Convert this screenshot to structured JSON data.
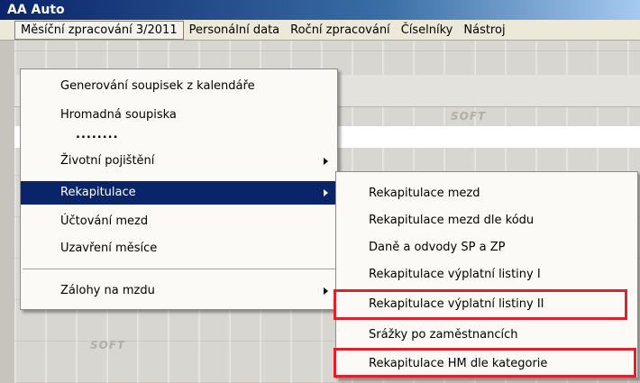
{
  "window": {
    "title": "AA Auto"
  },
  "menubar": {
    "items": [
      {
        "label": "Měsíční zpracování 3/2011"
      },
      {
        "label": "Personální data"
      },
      {
        "label": "Roční zpracování"
      },
      {
        "label": "Číselníky"
      },
      {
        "label": "Nástroj"
      }
    ]
  },
  "background": {
    "watermark": "SOFT"
  },
  "main_menu": {
    "items": [
      {
        "label": "Generování soupisek z kalendáře"
      },
      {
        "label": "Hromadná soupiska"
      },
      {
        "label": "........"
      },
      {
        "label": "Životní pojištění"
      },
      {
        "label": "Rekapitulace"
      },
      {
        "label": "Účtování mezd"
      },
      {
        "label": "Uzavření měsíce"
      },
      {
        "label": "Zálohy na mzdu"
      }
    ]
  },
  "submenu": {
    "items": [
      {
        "label": "Rekapitulace mezd"
      },
      {
        "label": "Rekapitulace mezd dle kódu"
      },
      {
        "label": "Daně a odvody SP a ZP"
      },
      {
        "label": "Rekapitulace výplatní listiny I"
      },
      {
        "label": "Rekapitulace výplatní listiny II"
      },
      {
        "label": "Srážky po zaměstnancích"
      },
      {
        "label": "Rekapitulace HM dle kategorie"
      }
    ]
  },
  "colors": {
    "highlight_box": "#e0202a",
    "selection": "#0a246a"
  }
}
